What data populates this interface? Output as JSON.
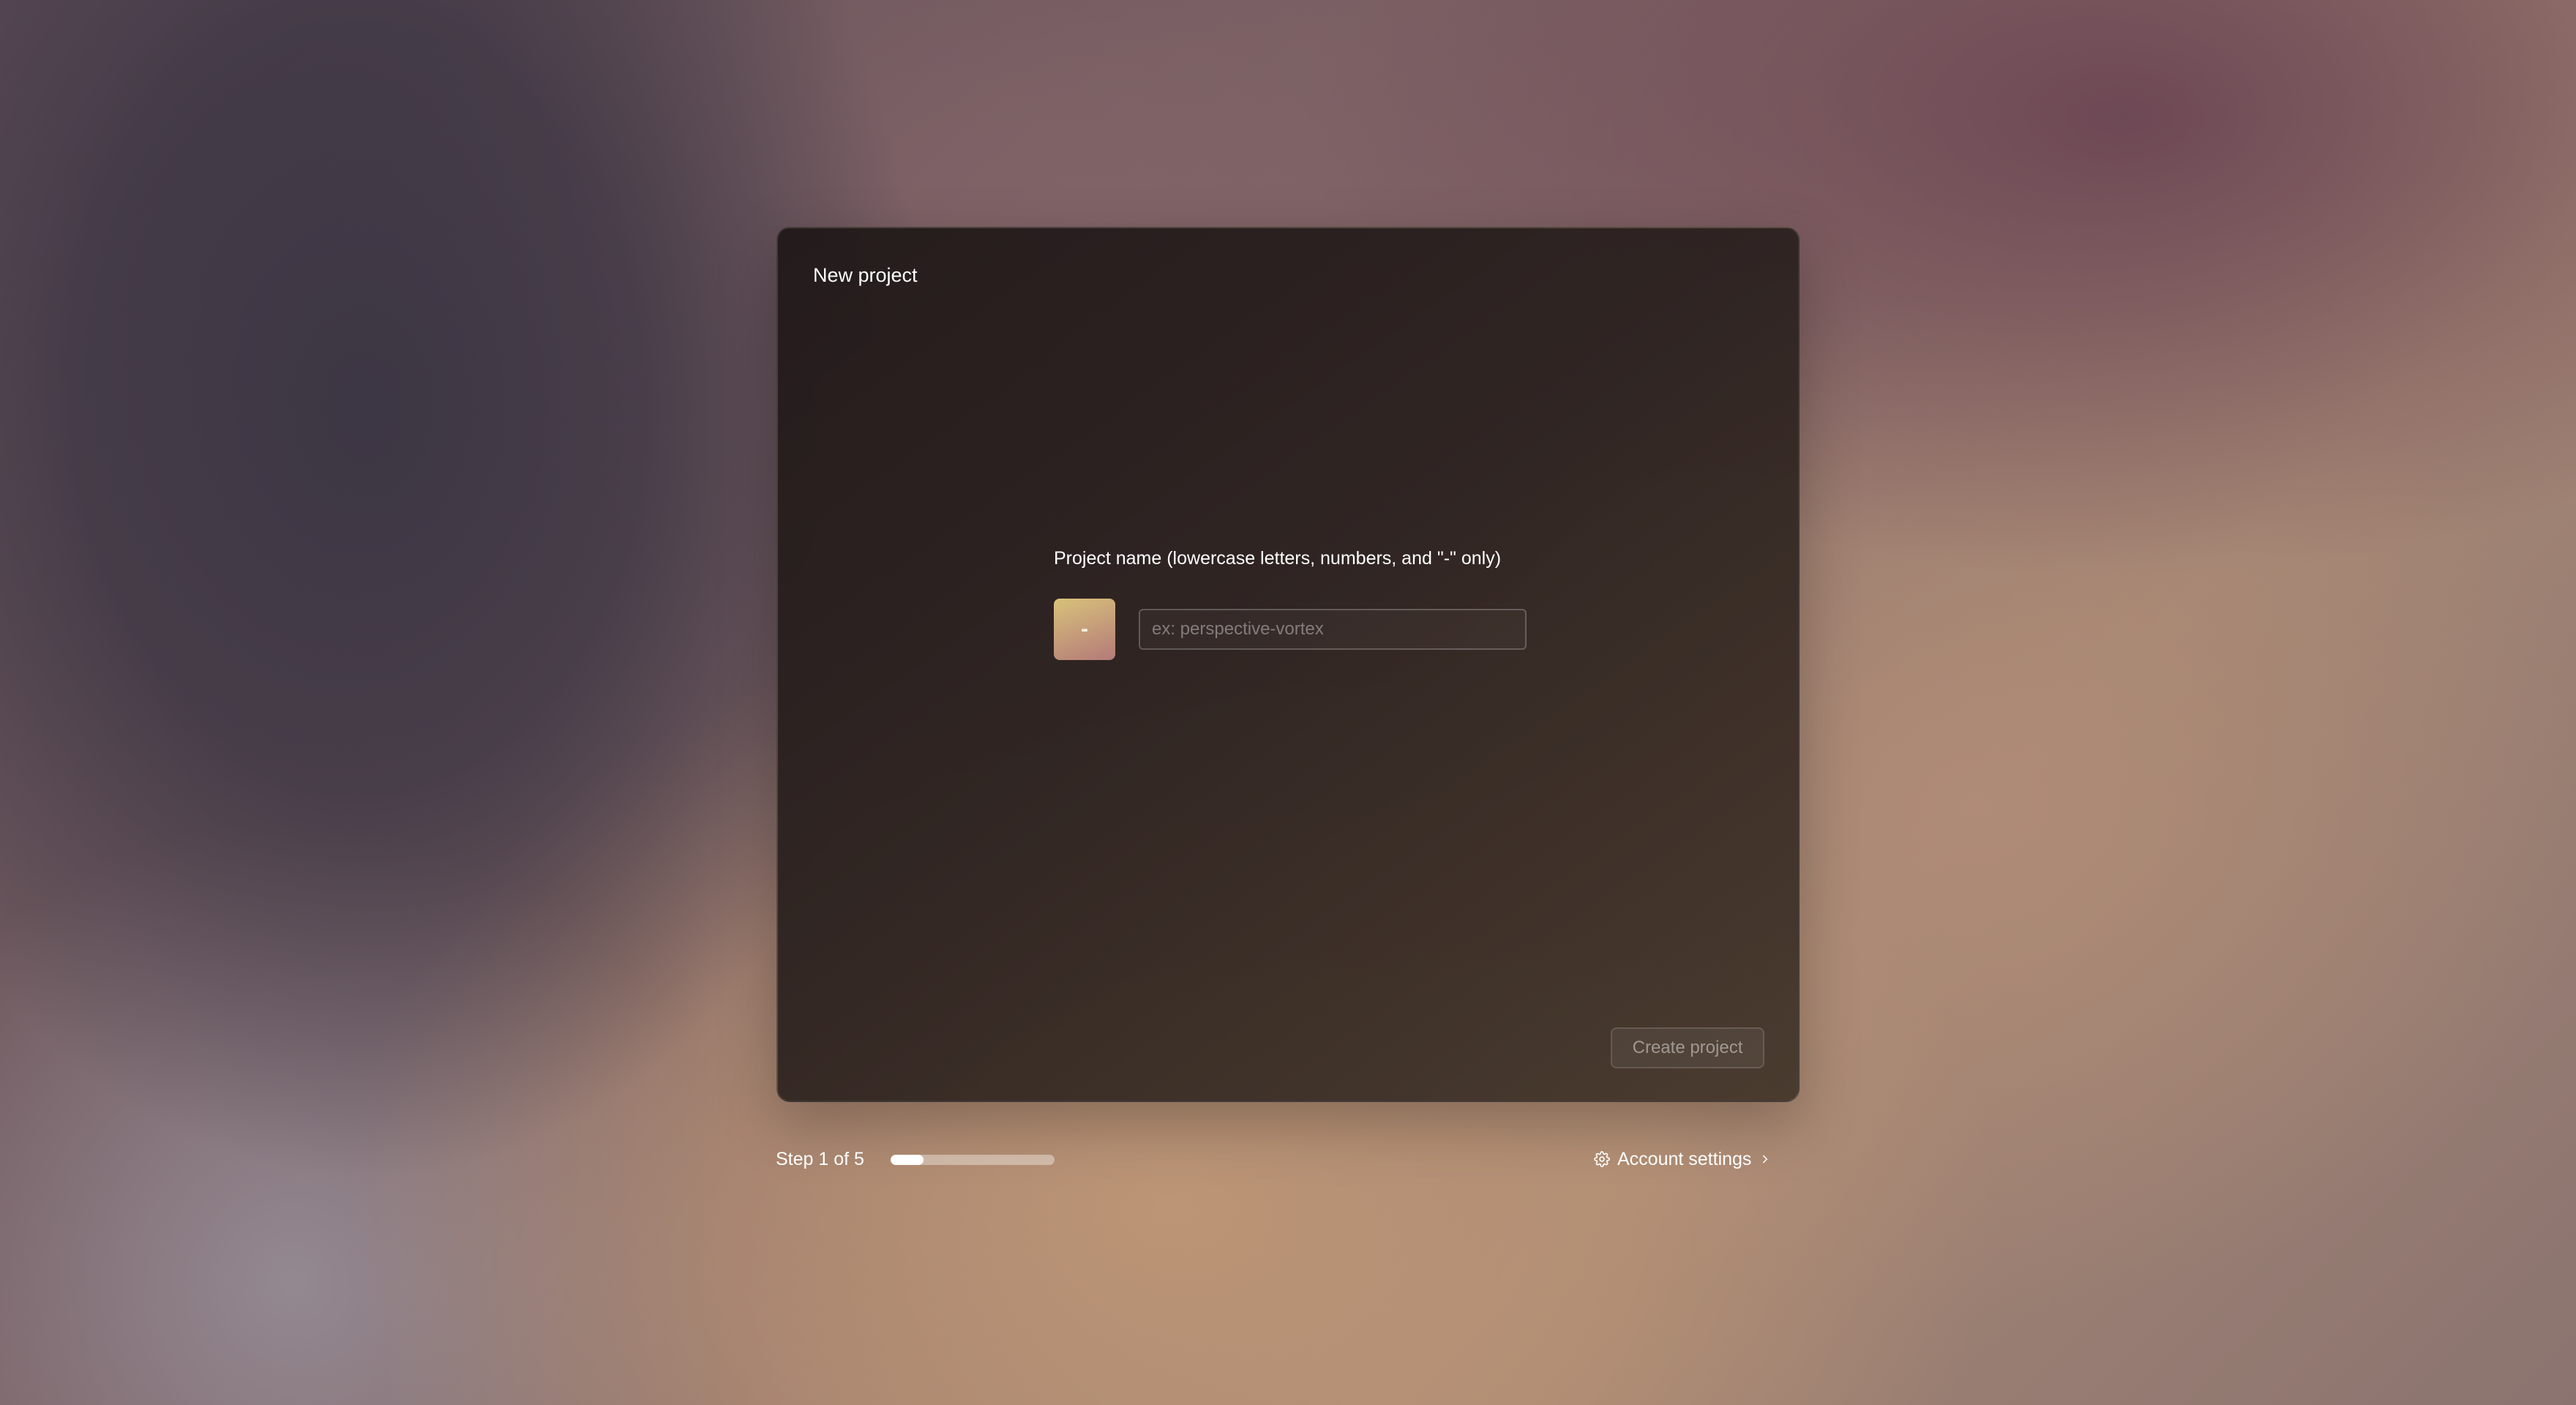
{
  "dialog": {
    "title": "New project"
  },
  "project_name": {
    "label": "Project name (lowercase letters, numbers, and \"-\" only)",
    "placeholder": "ex: perspective-vortex",
    "value": "",
    "avatar_text": "-"
  },
  "actions": {
    "create_label": "Create project"
  },
  "footer": {
    "step_label": "Step 1 of 5",
    "progress": 0.2,
    "account_settings_label": "Account settings",
    "account_settings_icon": "gear-icon",
    "chevron_icon": "chevron-right-icon"
  }
}
